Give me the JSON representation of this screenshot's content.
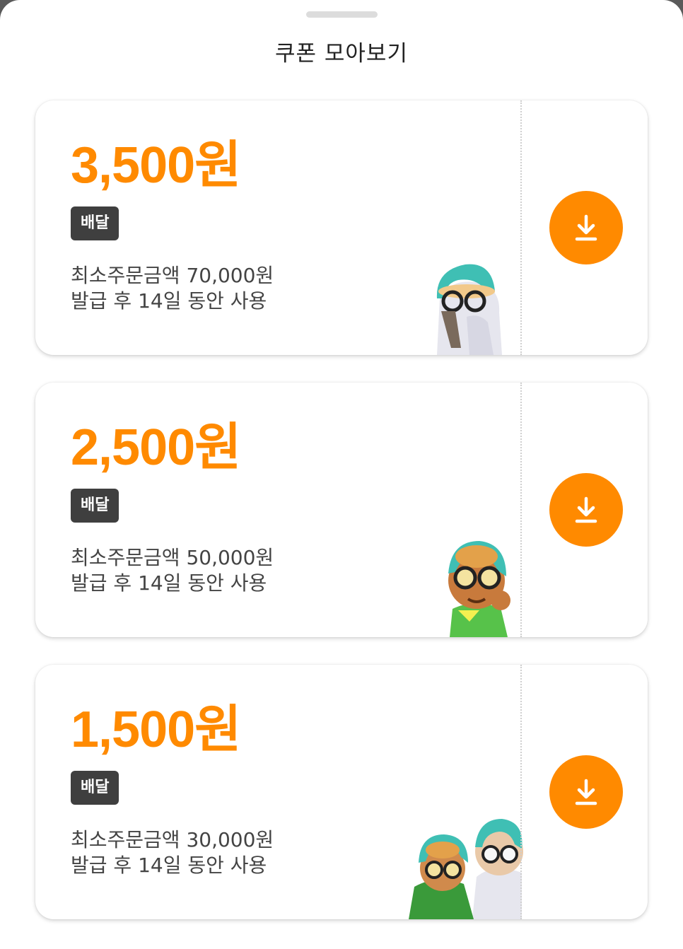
{
  "sheet": {
    "title": "쿠폰 모아보기"
  },
  "coupons": [
    {
      "amount": "3,500원",
      "tag": "배달",
      "min_order": "최소주문금액 70,000원",
      "validity": "발급 후 14일 동안 사용"
    },
    {
      "amount": "2,500원",
      "tag": "배달",
      "min_order": "최소주문금액 50,000원",
      "validity": "발급 후 14일 동안 사용"
    },
    {
      "amount": "1,500원",
      "tag": "배달",
      "min_order": "최소주문금액 30,000원",
      "validity": "발급 후 14일 동안 사용"
    }
  ],
  "icons": {
    "download": "download-icon",
    "character": "character-illustration"
  },
  "colors": {
    "accent": "#ff8a00",
    "tag_bg": "#3f3f3f",
    "text": "#444444"
  }
}
